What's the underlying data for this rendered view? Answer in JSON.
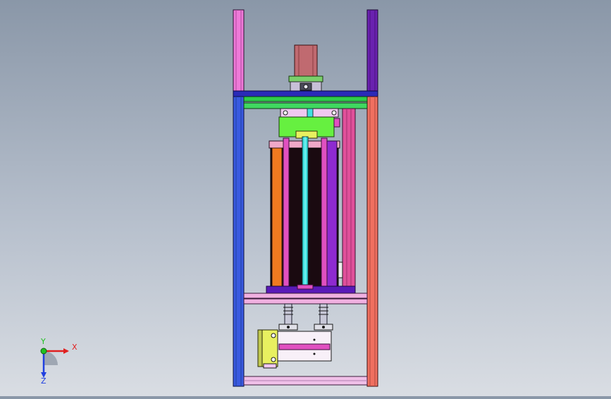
{
  "window": {
    "title": ""
  },
  "triad": {
    "x_label": "X",
    "y_label": "Y",
    "z_label": "Z",
    "x_color": "#e02020",
    "y_color": "#20c020",
    "z_color": "#2040e0"
  },
  "colors": {
    "bg_top": "#8a97a8",
    "bg_bottom": "#d9dde3",
    "post_left_top": "#ee7ad8",
    "post_right_top": "#6a22b0",
    "post_left_main": "#3a5ae0",
    "post_right_main": "#f07060",
    "top_beam": "#2a2ab8",
    "green_plate": "#2ecc4a",
    "lime_block": "#66f040",
    "motor": "#c06a70",
    "cylinder_black": "#1a0a10",
    "orange_side": "#f07a20",
    "magenta": "#e050c0",
    "purple": "#8e2ad0",
    "cyan_rod": "#40e0e0",
    "pink_rail": "#f0b0e0",
    "base_plate": "#5a1ab8",
    "yellow_block": "#e8f060",
    "bottom_frame": "#f0c0e8"
  }
}
